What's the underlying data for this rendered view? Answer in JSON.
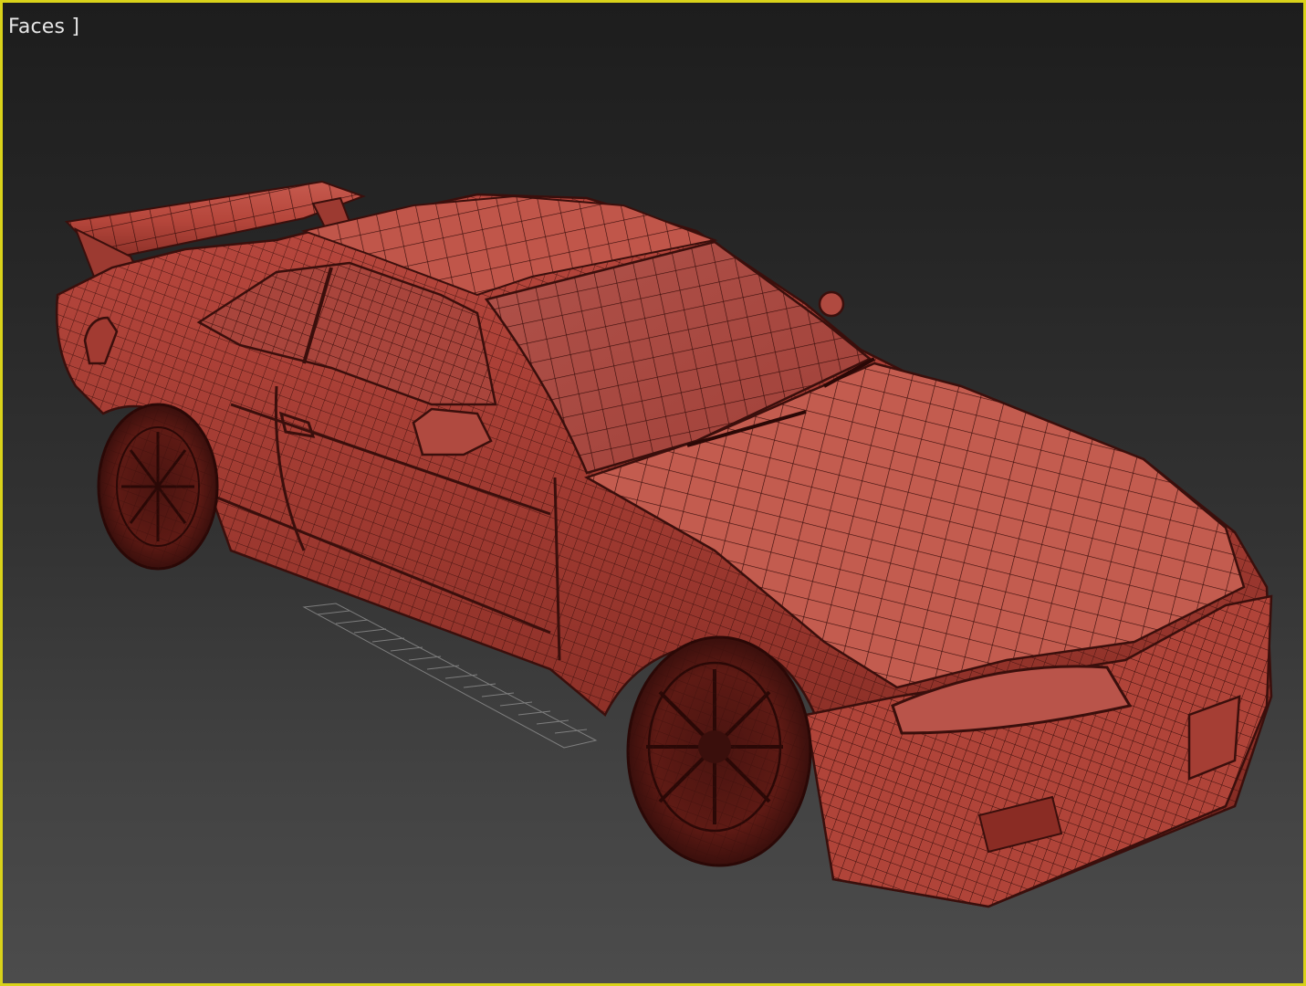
{
  "viewport": {
    "label": "Faces ]",
    "border_color": "#d9d21a",
    "shading_mode": "faces",
    "object_color": "#b9463c",
    "wire_color": "#3a0f0c"
  }
}
